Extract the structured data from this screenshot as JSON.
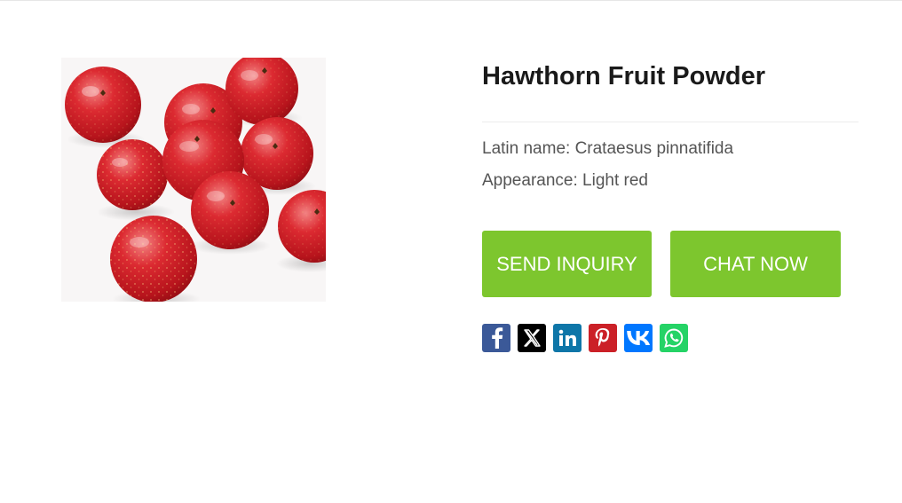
{
  "product": {
    "title": "Hawthorn Fruit Powder",
    "image_subject": "red-hawthorn-berries",
    "specs": [
      {
        "text": "Latin name: Crataesus pinnatifida"
      },
      {
        "text": "Appearance: Light red"
      }
    ]
  },
  "actions": {
    "send_inquiry_label": "SEND INQUIRY",
    "chat_now_label": "CHAT NOW",
    "button_color": "#7dc62e"
  },
  "share": [
    {
      "icon": "facebook-icon",
      "color": "#3b5998"
    },
    {
      "icon": "x-icon",
      "color": "#000000"
    },
    {
      "icon": "linkedin-icon",
      "color": "#0e76a8"
    },
    {
      "icon": "pinterest-icon",
      "color": "#cb2027"
    },
    {
      "icon": "vk-icon",
      "color": "#0077ff"
    },
    {
      "icon": "whatsapp-icon",
      "color": "#25d366"
    }
  ]
}
